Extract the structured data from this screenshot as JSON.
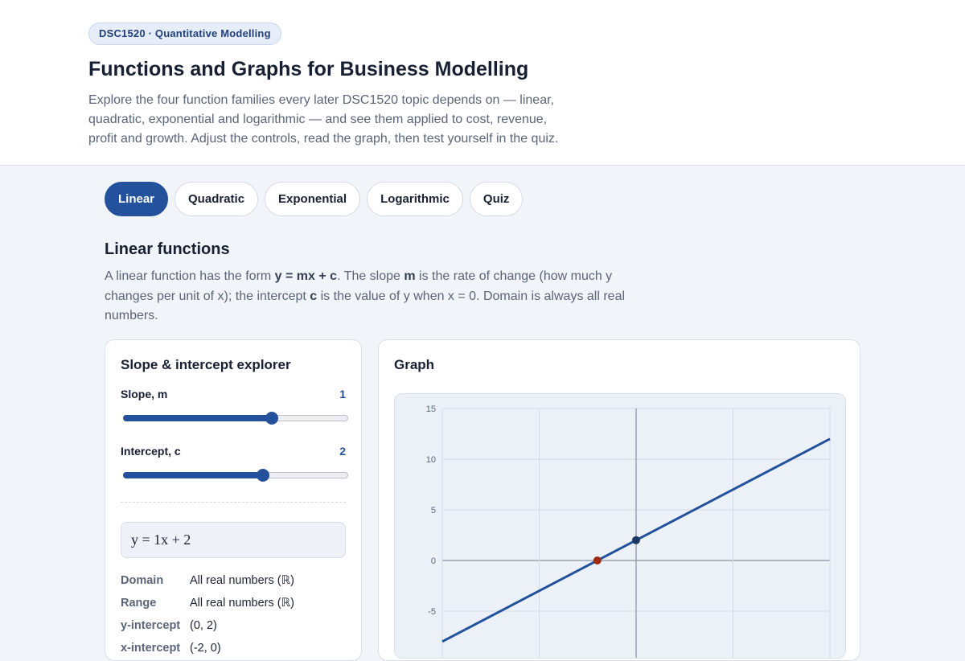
{
  "header": {
    "badge": "DSC1520 · Quantitative Modelling",
    "title": "Functions and Graphs for Business Modelling",
    "lead": "Explore the four function families every later DSC1520 topic depends on — linear, quadratic, exponential and logarithmic — and see them applied to cost, revenue, profit and growth. Adjust the controls, read the graph, then test yourself in the quiz."
  },
  "tabs": [
    {
      "label": "Linear",
      "active": true
    },
    {
      "label": "Quadratic",
      "active": false
    },
    {
      "label": "Exponential",
      "active": false
    },
    {
      "label": "Logarithmic",
      "active": false
    },
    {
      "label": "Quiz",
      "active": false
    }
  ],
  "section": {
    "title": "Linear functions",
    "desc_1": "A linear function has the form ",
    "desc_form": "y = mx + c",
    "desc_2": ". The slope ",
    "desc_m": "m",
    "desc_3": " is the rate of change (how much y changes per unit of x); the intercept ",
    "desc_c": "c",
    "desc_4": " is the value of y when x = 0. Domain is always all real numbers."
  },
  "explorer": {
    "title": "Slope & intercept explorer",
    "slope_label": "Slope, m",
    "slope_value": "1",
    "slope_fraction": 0.66,
    "intercept_label": "Intercept, c",
    "intercept_value": "2",
    "intercept_fraction": 0.62,
    "formula": "y = 1x + 2",
    "properties": [
      {
        "key": "Domain",
        "value": "All real numbers (ℝ)"
      },
      {
        "key": "Range",
        "value": "All real numbers (ℝ)"
      },
      {
        "key": "y-intercept",
        "value": "(0, 2)"
      },
      {
        "key": "x-intercept",
        "value": "(-2, 0)"
      }
    ]
  },
  "graph": {
    "title": "Graph"
  },
  "chart_data": {
    "type": "line",
    "title": "",
    "xlabel": "",
    "ylabel": "",
    "xlim": [
      -10,
      10
    ],
    "ylim": [
      -10,
      15
    ],
    "y_ticks": [
      15,
      10,
      5,
      0,
      -5
    ],
    "x_grid": [
      -10,
      -5,
      0,
      5,
      10
    ],
    "grid": true,
    "series": [
      {
        "x": [
          -10,
          10
        ],
        "y": [
          -8,
          12
        ],
        "color": "#23519c"
      }
    ],
    "points": [
      {
        "x": -2,
        "y": 0,
        "color": "#a02a12"
      },
      {
        "x": 0,
        "y": 2,
        "color": "#1c3966"
      }
    ]
  }
}
